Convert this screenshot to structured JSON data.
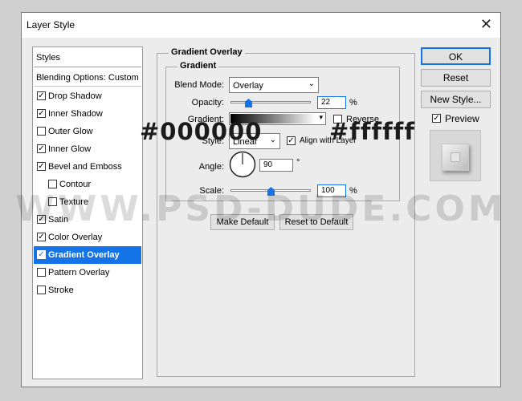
{
  "window": {
    "title": "Layer Style"
  },
  "left": {
    "styles_label": "Styles",
    "blending_label": "Blending Options: Custom",
    "items": [
      {
        "label": "Drop Shadow",
        "checked": true
      },
      {
        "label": "Inner Shadow",
        "checked": true
      },
      {
        "label": "Outer Glow",
        "checked": false
      },
      {
        "label": "Inner Glow",
        "checked": true
      },
      {
        "label": "Bevel and Emboss",
        "checked": true
      },
      {
        "label": "Contour",
        "checked": false
      },
      {
        "label": "Texture",
        "checked": false
      },
      {
        "label": "Satin",
        "checked": true
      },
      {
        "label": "Color Overlay",
        "checked": true
      },
      {
        "label": "Gradient Overlay",
        "checked": true,
        "selected": true
      },
      {
        "label": "Pattern Overlay",
        "checked": false
      },
      {
        "label": "Stroke",
        "checked": false
      }
    ]
  },
  "section": {
    "title": "Gradient Overlay",
    "group": "Gradient",
    "blend_mode_label": "Blend Mode:",
    "blend_mode_value": "Overlay",
    "opacity_label": "Opacity:",
    "opacity_value": "22",
    "opacity_unit": "%",
    "opacity_fraction": 0.22,
    "gradient_label": "Gradient:",
    "reverse_label": "Reverse",
    "reverse_checked": false,
    "style_label": "Style:",
    "style_value": "Linear",
    "align_label": "Align with Layer",
    "align_checked": true,
    "angle_label": "Angle:",
    "angle_value": "90",
    "angle_unit": "°",
    "scale_label": "Scale:",
    "scale_value": "100",
    "scale_unit": "%",
    "scale_fraction": 0.5,
    "make_default_label": "Make Default",
    "reset_default_label": "Reset to Default"
  },
  "right": {
    "ok_label": "OK",
    "reset_label": "Reset",
    "new_style_label": "New Style...",
    "preview_label": "Preview",
    "preview_checked": true
  },
  "overlay": {
    "color_start": "#000000",
    "color_end": "#ffffff",
    "watermark": "WWW.PSD-DUDE.COM"
  },
  "colors": {
    "accent": "#1473e6"
  }
}
